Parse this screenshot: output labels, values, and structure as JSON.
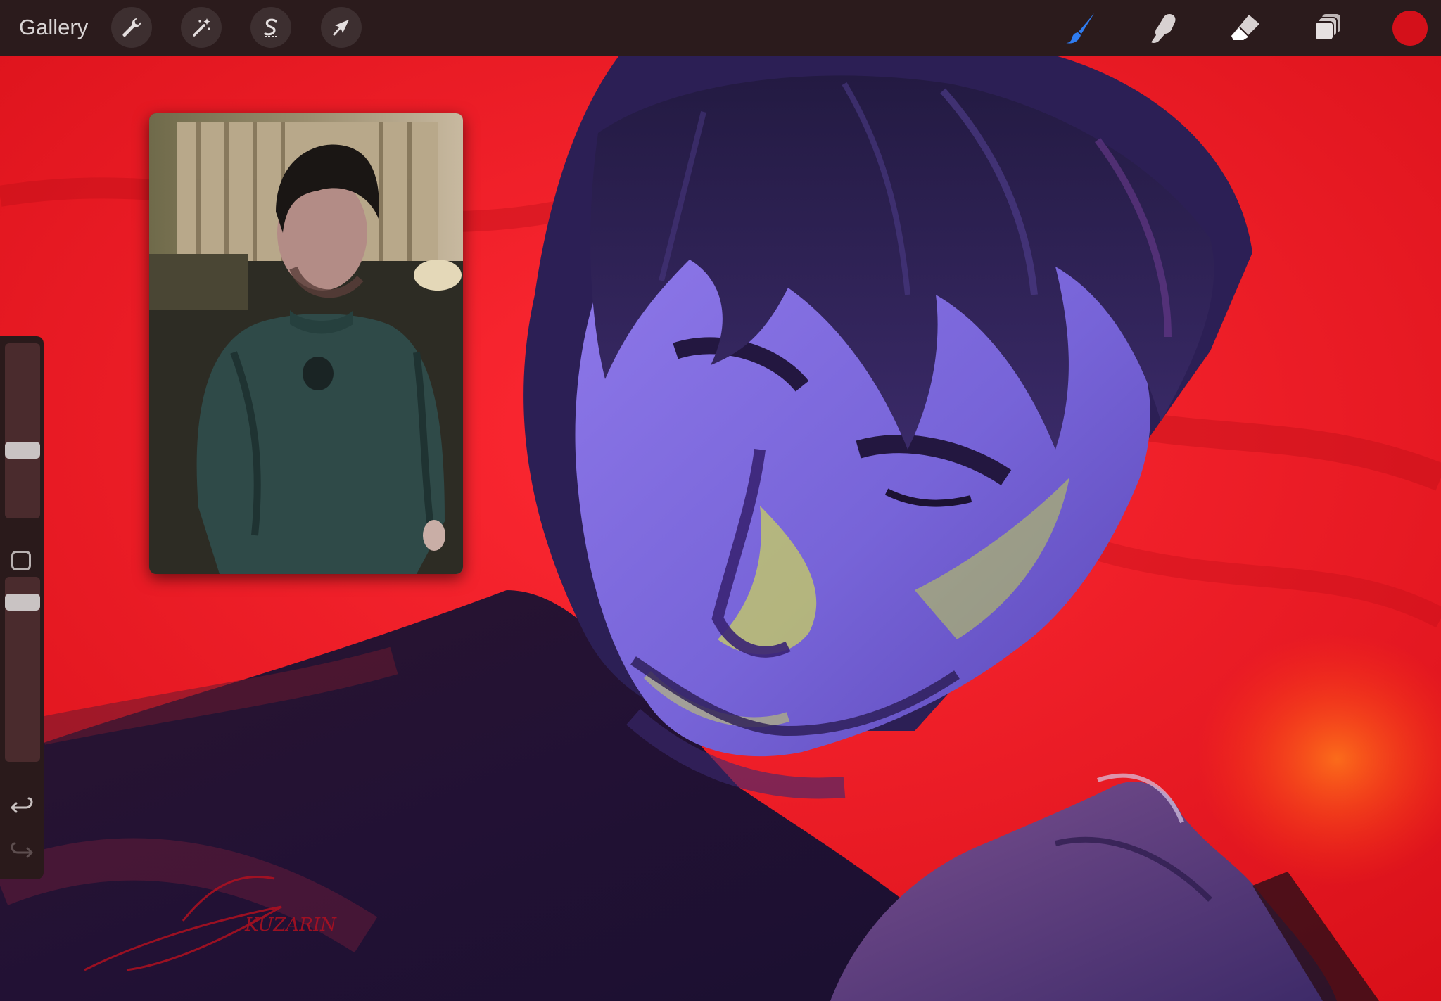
{
  "toolbar": {
    "gallery_label": "Gallery",
    "left_tools": [
      {
        "name": "actions",
        "icon": "wrench-icon"
      },
      {
        "name": "adjustments",
        "icon": "magic-wand-icon"
      },
      {
        "name": "selection",
        "icon": "selection-s-icon"
      },
      {
        "name": "transform",
        "icon": "arrow-cursor-icon"
      }
    ],
    "right_tools": [
      {
        "name": "brush",
        "icon": "paintbrush-icon",
        "active": true,
        "color": "#2f7cf0"
      },
      {
        "name": "smudge",
        "icon": "smudge-finger-icon",
        "active": false
      },
      {
        "name": "eraser",
        "icon": "eraser-icon",
        "active": false
      },
      {
        "name": "layers",
        "icon": "layers-icon",
        "active": false
      }
    ],
    "current_color": "#d4101a"
  },
  "sidebar": {
    "brush_size_level": 0.38,
    "brush_opacity_level": 0.1,
    "icons": [
      "modify-square-icon",
      "undo-icon",
      "redo-icon"
    ]
  },
  "canvas": {
    "background_color": "#e8131d",
    "signature_text": "KUZARIN",
    "reference_window": true
  }
}
